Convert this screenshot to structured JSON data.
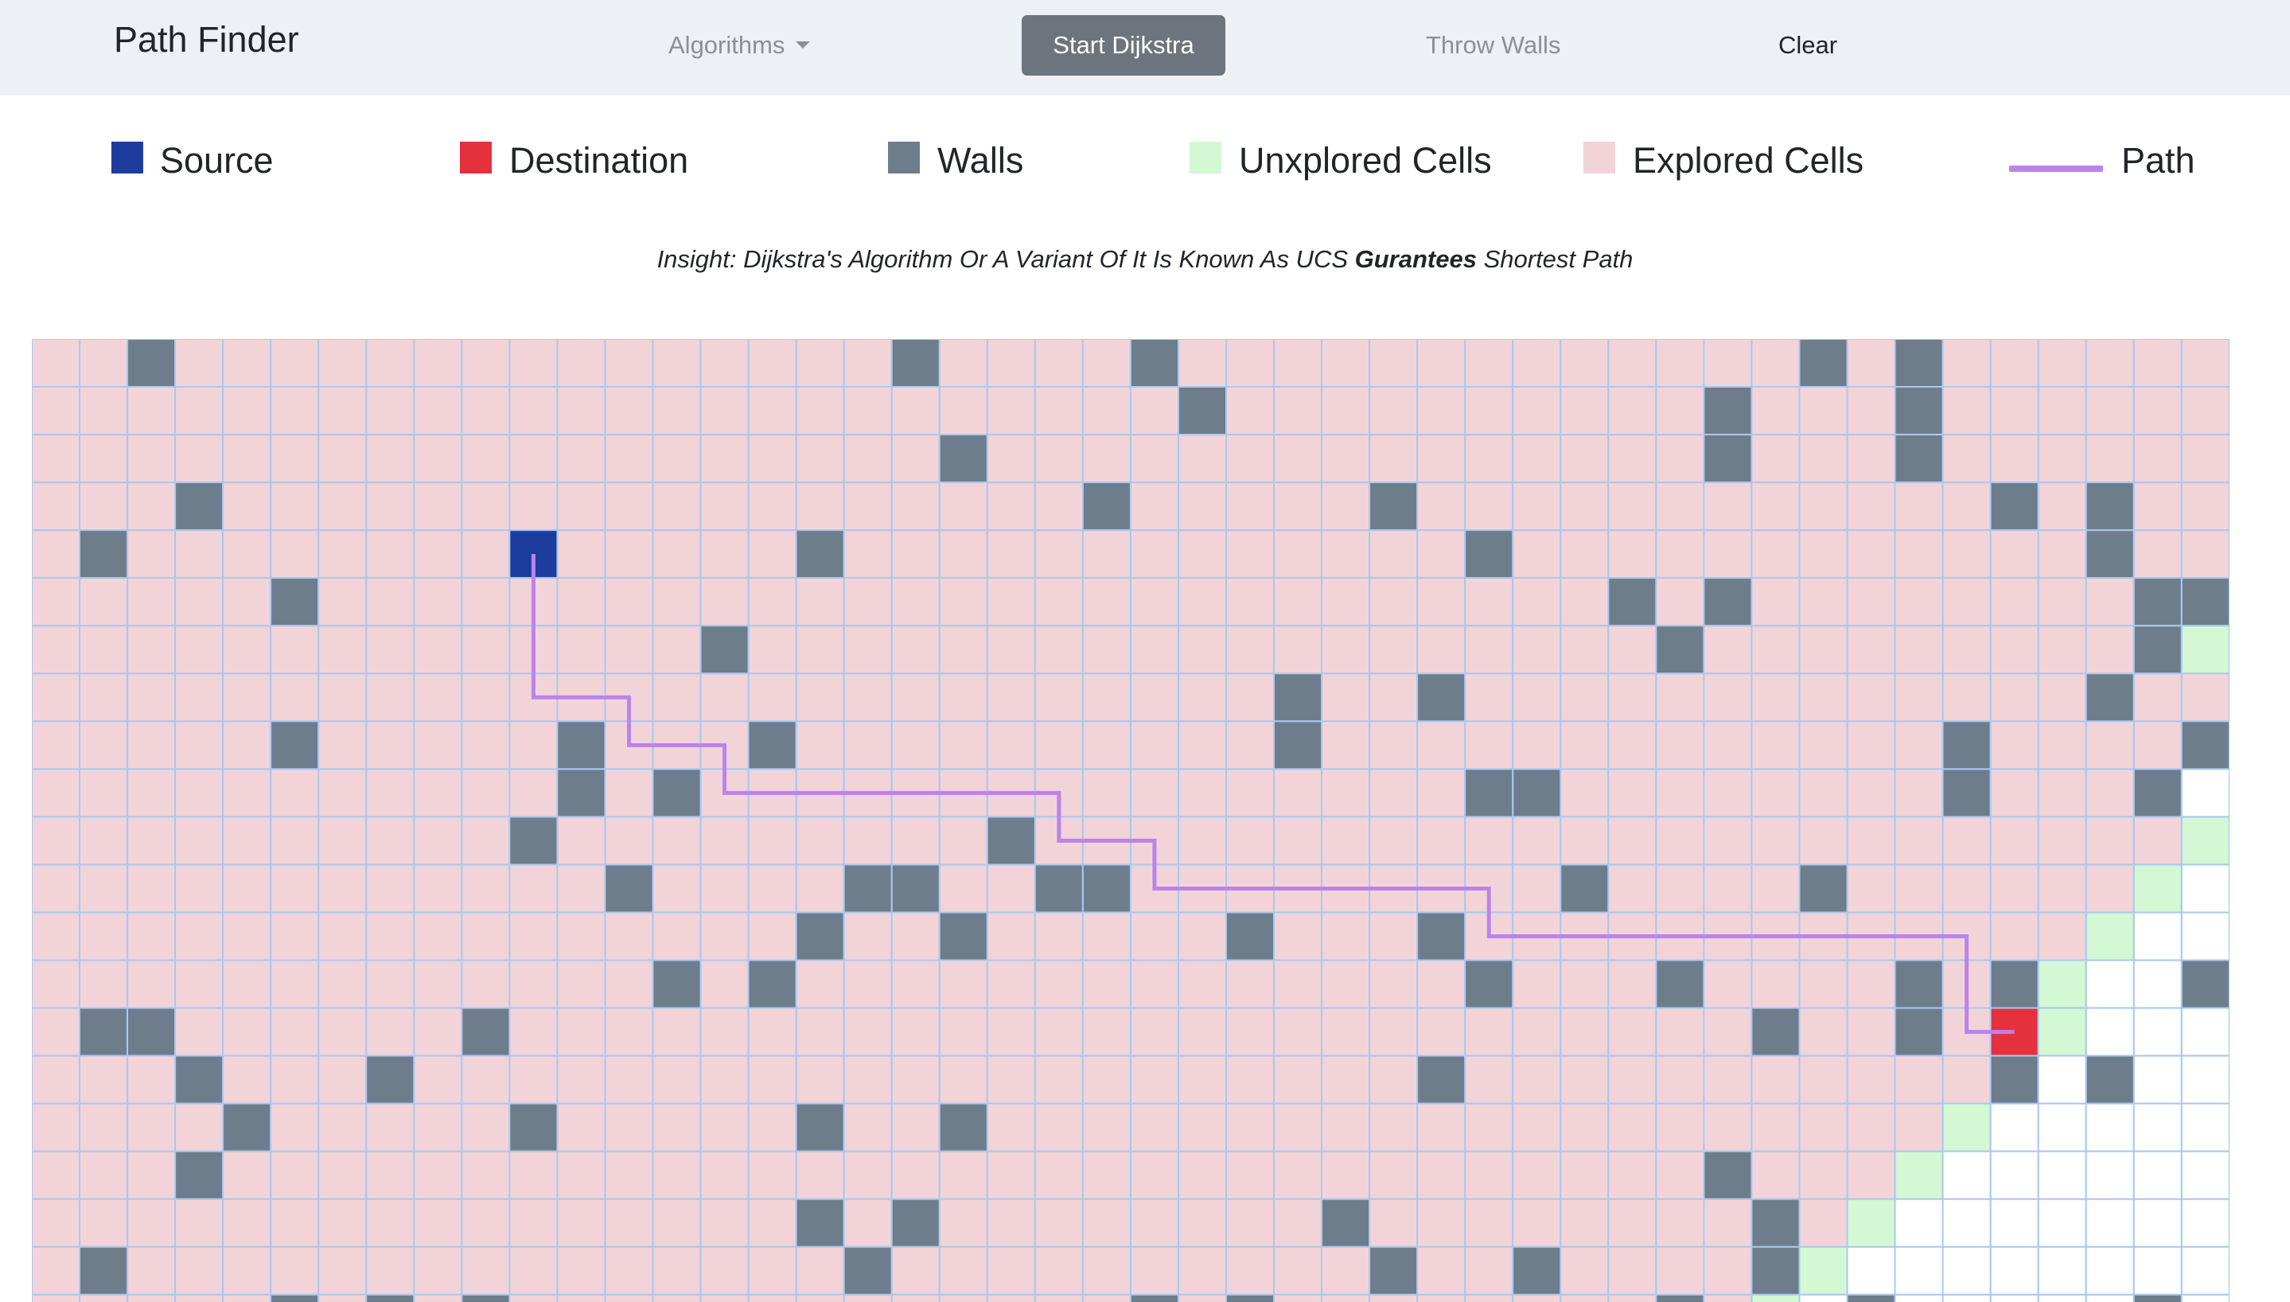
{
  "navbar": {
    "brand": "Path Finder",
    "algorithms_label": "Algorithms",
    "start_label": "Start Dijkstra",
    "throw_walls_label": "Throw Walls",
    "clear_label": "Clear"
  },
  "legend": {
    "source": "Source",
    "destination": "Destination",
    "walls": "Walls",
    "unexplored": "Unxplored Cells",
    "explored": "Explored Cells",
    "path": "Path"
  },
  "insight": {
    "prefix": "Insight: Dijkstra's Algorithm Or A Variant Of It Is Known As UCS ",
    "emphasis": "Gurantees",
    "suffix": " Shortest Path"
  },
  "colors": {
    "source": "#1c3d9e",
    "destination": "#e5313e",
    "wall": "#6e7d8c",
    "unexplored": "#d3f8d3",
    "explored": "#f2d4d8",
    "empty": "#ffffff",
    "grid_line": "#a9c8f0",
    "path": "#bb83ec"
  },
  "grid": {
    "cols": 46,
    "rows_visible": 21,
    "source": [
      4,
      10
    ],
    "destination": [
      14,
      41
    ],
    "walls": [
      [
        0,
        2
      ],
      [
        0,
        18
      ],
      [
        0,
        23
      ],
      [
        0,
        37
      ],
      [
        0,
        39
      ],
      [
        1,
        24
      ],
      [
        1,
        35
      ],
      [
        1,
        39
      ],
      [
        2,
        19
      ],
      [
        2,
        35
      ],
      [
        2,
        39
      ],
      [
        3,
        3
      ],
      [
        3,
        22
      ],
      [
        3,
        28
      ],
      [
        3,
        41
      ],
      [
        3,
        43
      ],
      [
        4,
        1
      ],
      [
        4,
        16
      ],
      [
        4,
        30
      ],
      [
        4,
        43
      ],
      [
        5,
        5
      ],
      [
        5,
        33
      ],
      [
        5,
        35
      ],
      [
        5,
        44
      ],
      [
        5,
        45
      ],
      [
        6,
        14
      ],
      [
        6,
        34
      ],
      [
        6,
        44
      ],
      [
        7,
        26
      ],
      [
        7,
        29
      ],
      [
        7,
        43
      ],
      [
        8,
        5
      ],
      [
        8,
        11
      ],
      [
        8,
        15
      ],
      [
        8,
        26
      ],
      [
        8,
        40
      ],
      [
        8,
        45
      ],
      [
        9,
        11
      ],
      [
        9,
        13
      ],
      [
        9,
        30
      ],
      [
        9,
        31
      ],
      [
        9,
        40
      ],
      [
        9,
        44
      ],
      [
        10,
        10
      ],
      [
        10,
        20
      ],
      [
        11,
        12
      ],
      [
        11,
        17
      ],
      [
        11,
        18
      ],
      [
        11,
        21
      ],
      [
        11,
        22
      ],
      [
        11,
        32
      ],
      [
        11,
        37
      ],
      [
        12,
        16
      ],
      [
        12,
        19
      ],
      [
        12,
        25
      ],
      [
        12,
        29
      ],
      [
        13,
        13
      ],
      [
        13,
        15
      ],
      [
        13,
        30
      ],
      [
        13,
        34
      ],
      [
        13,
        39
      ],
      [
        13,
        41
      ],
      [
        13,
        45
      ],
      [
        14,
        1
      ],
      [
        14,
        2
      ],
      [
        14,
        9
      ],
      [
        14,
        36
      ],
      [
        14,
        39
      ],
      [
        15,
        3
      ],
      [
        15,
        7
      ],
      [
        15,
        29
      ],
      [
        15,
        41
      ],
      [
        15,
        43
      ],
      [
        16,
        4
      ],
      [
        16,
        10
      ],
      [
        16,
        16
      ],
      [
        16,
        19
      ],
      [
        17,
        3
      ],
      [
        17,
        35
      ],
      [
        18,
        16
      ],
      [
        18,
        18
      ],
      [
        18,
        27
      ],
      [
        18,
        36
      ],
      [
        19,
        1
      ],
      [
        19,
        17
      ],
      [
        19,
        28
      ],
      [
        19,
        31
      ],
      [
        19,
        36
      ],
      [
        20,
        5
      ],
      [
        20,
        7
      ],
      [
        20,
        9
      ],
      [
        20,
        23
      ],
      [
        20,
        25
      ],
      [
        20,
        34
      ],
      [
        20,
        38
      ],
      [
        20,
        44
      ]
    ],
    "unexplored": [
      [
        6,
        45
      ],
      [
        10,
        45
      ],
      [
        11,
        44
      ],
      [
        12,
        43
      ],
      [
        13,
        42
      ],
      [
        14,
        42
      ],
      [
        16,
        40
      ],
      [
        17,
        39
      ],
      [
        18,
        38
      ],
      [
        19,
        37
      ],
      [
        20,
        36
      ]
    ],
    "empty": [
      [
        9,
        45
      ],
      [
        11,
        45
      ],
      [
        12,
        44
      ],
      [
        12,
        45
      ],
      [
        13,
        43
      ],
      [
        13,
        44
      ],
      [
        14,
        43
      ],
      [
        14,
        44
      ],
      [
        14,
        45
      ],
      [
        15,
        42
      ],
      [
        15,
        44
      ],
      [
        15,
        45
      ],
      [
        16,
        41
      ],
      [
        16,
        42
      ],
      [
        16,
        43
      ],
      [
        16,
        44
      ],
      [
        16,
        45
      ],
      [
        17,
        40
      ],
      [
        17,
        41
      ],
      [
        17,
        42
      ],
      [
        17,
        43
      ],
      [
        17,
        44
      ],
      [
        17,
        45
      ],
      [
        18,
        39
      ],
      [
        18,
        40
      ],
      [
        18,
        41
      ],
      [
        18,
        42
      ],
      [
        18,
        43
      ],
      [
        18,
        44
      ],
      [
        18,
        45
      ],
      [
        19,
        38
      ],
      [
        19,
        39
      ],
      [
        19,
        40
      ],
      [
        19,
        41
      ],
      [
        19,
        42
      ],
      [
        19,
        43
      ],
      [
        19,
        44
      ],
      [
        19,
        45
      ],
      [
        20,
        37
      ],
      [
        20,
        39
      ],
      [
        20,
        40
      ],
      [
        20,
        41
      ],
      [
        20,
        42
      ],
      [
        20,
        43
      ],
      [
        20,
        45
      ]
    ],
    "path": [
      [
        4,
        10
      ],
      [
        5,
        10
      ],
      [
        6,
        10
      ],
      [
        7,
        10
      ],
      [
        7,
        11
      ],
      [
        7,
        12
      ],
      [
        8,
        12
      ],
      [
        8,
        13
      ],
      [
        8,
        14
      ],
      [
        9,
        14
      ],
      [
        9,
        15
      ],
      [
        9,
        16
      ],
      [
        9,
        17
      ],
      [
        9,
        18
      ],
      [
        9,
        19
      ],
      [
        9,
        20
      ],
      [
        9,
        21
      ],
      [
        10,
        21
      ],
      [
        10,
        22
      ],
      [
        10,
        23
      ],
      [
        11,
        23
      ],
      [
        11,
        24
      ],
      [
        11,
        25
      ],
      [
        11,
        26
      ],
      [
        11,
        27
      ],
      [
        11,
        28
      ],
      [
        11,
        29
      ],
      [
        11,
        30
      ],
      [
        12,
        30
      ],
      [
        12,
        31
      ],
      [
        12,
        32
      ],
      [
        12,
        33
      ],
      [
        12,
        34
      ],
      [
        12,
        35
      ],
      [
        12,
        36
      ],
      [
        12,
        37
      ],
      [
        12,
        38
      ],
      [
        12,
        39
      ],
      [
        12,
        40
      ],
      [
        13,
        40
      ],
      [
        14,
        40
      ],
      [
        14,
        41
      ]
    ]
  }
}
